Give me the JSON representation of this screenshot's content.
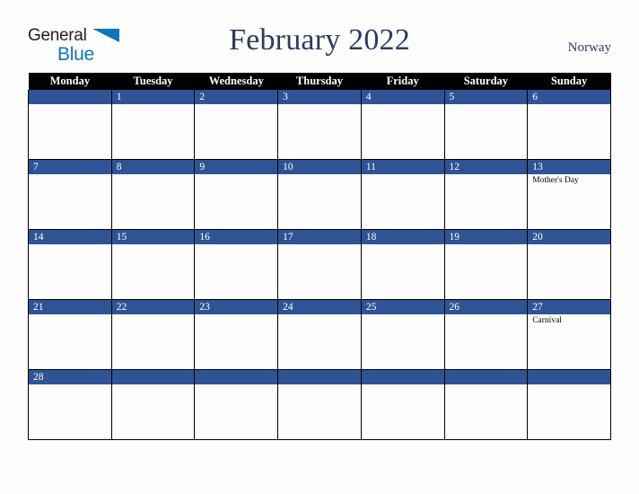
{
  "logo": {
    "word_one": "General",
    "word_two": "Blue",
    "triangle_icon": "blue-triangle-icon",
    "brand_blue": "#0e76bc",
    "text_dark": "#231f20"
  },
  "header": {
    "title": "February 2022",
    "country": "Norway",
    "title_color": "#2b3b60"
  },
  "calendar": {
    "accent_blue": "#2f5496",
    "header_bg": "#000000",
    "weekdays": [
      "Monday",
      "Tuesday",
      "Wednesday",
      "Thursday",
      "Friday",
      "Saturday",
      "Sunday"
    ],
    "weeks": [
      [
        {
          "day": "",
          "events": []
        },
        {
          "day": "1",
          "events": []
        },
        {
          "day": "2",
          "events": []
        },
        {
          "day": "3",
          "events": []
        },
        {
          "day": "4",
          "events": []
        },
        {
          "day": "5",
          "events": []
        },
        {
          "day": "6",
          "events": []
        }
      ],
      [
        {
          "day": "7",
          "events": []
        },
        {
          "day": "8",
          "events": []
        },
        {
          "day": "9",
          "events": []
        },
        {
          "day": "10",
          "events": []
        },
        {
          "day": "11",
          "events": []
        },
        {
          "day": "12",
          "events": []
        },
        {
          "day": "13",
          "events": [
            "Mother's Day"
          ]
        }
      ],
      [
        {
          "day": "14",
          "events": []
        },
        {
          "day": "15",
          "events": []
        },
        {
          "day": "16",
          "events": []
        },
        {
          "day": "17",
          "events": []
        },
        {
          "day": "18",
          "events": []
        },
        {
          "day": "19",
          "events": []
        },
        {
          "day": "20",
          "events": []
        }
      ],
      [
        {
          "day": "21",
          "events": []
        },
        {
          "day": "22",
          "events": []
        },
        {
          "day": "23",
          "events": []
        },
        {
          "day": "24",
          "events": []
        },
        {
          "day": "25",
          "events": []
        },
        {
          "day": "26",
          "events": []
        },
        {
          "day": "27",
          "events": [
            "Carnival"
          ]
        }
      ],
      [
        {
          "day": "28",
          "events": []
        },
        {
          "day": "",
          "events": []
        },
        {
          "day": "",
          "events": []
        },
        {
          "day": "",
          "events": []
        },
        {
          "day": "",
          "events": []
        },
        {
          "day": "",
          "events": []
        },
        {
          "day": "",
          "events": []
        }
      ]
    ]
  }
}
